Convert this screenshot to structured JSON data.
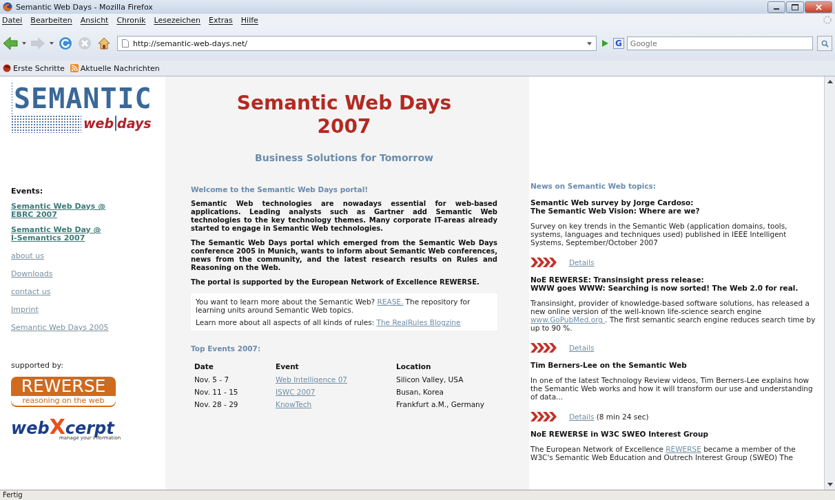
{
  "window": {
    "title": "Semantic Web Days - Mozilla Firefox"
  },
  "menu": [
    "Datei",
    "Bearbeiten",
    "Ansicht",
    "Chronik",
    "Lesezeichen",
    "Extras",
    "Hilfe"
  ],
  "address": {
    "value": "http://semantic-web-days.net/"
  },
  "search": {
    "engine": "G",
    "placeholder": "Google"
  },
  "bookmarks": [
    {
      "label": "Erste Schritte",
      "kind": "firefox"
    },
    {
      "label": "Aktuelle Nachrichten",
      "kind": "feed"
    }
  ],
  "sidebar": {
    "logo": {
      "word": "SEMANTIC",
      "web": "web",
      "days": "days"
    },
    "heading": "Events:",
    "links": [
      {
        "lines": [
          "Semantic Web Days @",
          "EBRC 2007"
        ],
        "kind": "event"
      },
      {
        "lines": [
          "Semantic Web Day @",
          "I-Semantics 2007"
        ],
        "kind": "event"
      },
      {
        "lines": [
          "about us"
        ],
        "kind": "page"
      },
      {
        "lines": [
          "Downloads"
        ],
        "kind": "page"
      },
      {
        "lines": [
          "contact us"
        ],
        "kind": "page"
      },
      {
        "lines": [
          "Imprint"
        ],
        "kind": "page"
      },
      {
        "lines": [
          "Semantic Web Days 2005"
        ],
        "kind": "page"
      }
    ],
    "supported_label": "supported by:",
    "sponsors": [
      {
        "kind": "rewerse",
        "name": "REWERSE",
        "tagline": "reasoning on the web"
      },
      {
        "kind": "webxcerpt",
        "name": "web",
        "mark": "X",
        "rest": "cerpt",
        "tagline": "manage your information"
      }
    ]
  },
  "main": {
    "title_lines": [
      "Semantic Web Days",
      "2007"
    ],
    "subtitle": "Business Solutions for Tomorrow",
    "welcome": "Welcome to the Semantic Web Days portal!",
    "paragraphs": [
      "Semantic Web technologies are nowadays essential for web-based applications. Leading analysts such as Gartner add Semantic Web technologies to the key technology themes. Many corporate IT-areas already started to engage in Semantic Web technologies.",
      "The Semantic Web Days portal which emerged from the Semantic Web Days conference 2005 in Munich, wants to inform about Semantic Web conferences, news from the community, and the latest research results on Rules and Reasoning on the Web.",
      "The portal is supported by the European Network of Excellence REWERSE."
    ],
    "info": [
      {
        "before": "You want to learn more about the Semantic Web? ",
        "link": "REASE.",
        "after": " The repository for learning units around Semantic Web topics."
      },
      {
        "before": "Learn more about all aspects of all kinds of rules: ",
        "link": "The RealRules Blogzine"
      }
    ],
    "events_heading": "Top Events 2007:",
    "columns": [
      "Date",
      "Event",
      "Location"
    ],
    "rows": [
      {
        "date": "Nov. 5 - 7",
        "event": "Web Intelligence 07",
        "location": "Silicon Valley, USA"
      },
      {
        "date": "Nov. 11 - 15",
        "event": "ISWC 2007",
        "location": "Busan, Korea"
      },
      {
        "date": "Nov. 28 - 29",
        "event": "KnowTech",
        "location": "Frankfurt a.M., Germany"
      }
    ]
  },
  "news": {
    "heading": "News on Semantic Web topics:",
    "items": [
      {
        "title_lines": [
          "Semantic Web survey by Jorge Cardoso:",
          "The Semantic Web Vision: Where are we?"
        ],
        "before": "Survey on key trends in the Semantic Web (application domains, tools, systems, languages and techniques used) published in IEEE Intelligent Systems, September/October 2007",
        "details": "Details"
      },
      {
        "title_lines": [
          "NoE REWERSE: Transinsight press release:",
          "WWW goes WWW: Searching is now sorted! The Web 2.0 for real."
        ],
        "before": "Transinsight, provider of knowledge-based software solutions, has released a new online version of the well-known life-science search engine ",
        "link": "www.GoPubMed.org ",
        "after": ". The first semantic search engine reduces search time by up to 90 %.",
        "details": "Details"
      },
      {
        "title_lines": [
          "Tim Berners-Lee on the Semantic Web"
        ],
        "before": "In one of the latest Technology Review videos, Tim Berners-Lee explains how the Semantic Web works and how it will transform our use and understanding of data...",
        "details": "Details",
        "note": " (8 min 24 sec)"
      },
      {
        "title_lines": [
          "NoE REWERSE in W3C SWEO Interest Group"
        ],
        "before": "The European Network of Excellence ",
        "link": "REWERSE",
        "after": " became a member of the W3C's Semantic Web Education and Outrech Interest Group (SWEO) The"
      }
    ]
  },
  "status_bar": "Fertig"
}
